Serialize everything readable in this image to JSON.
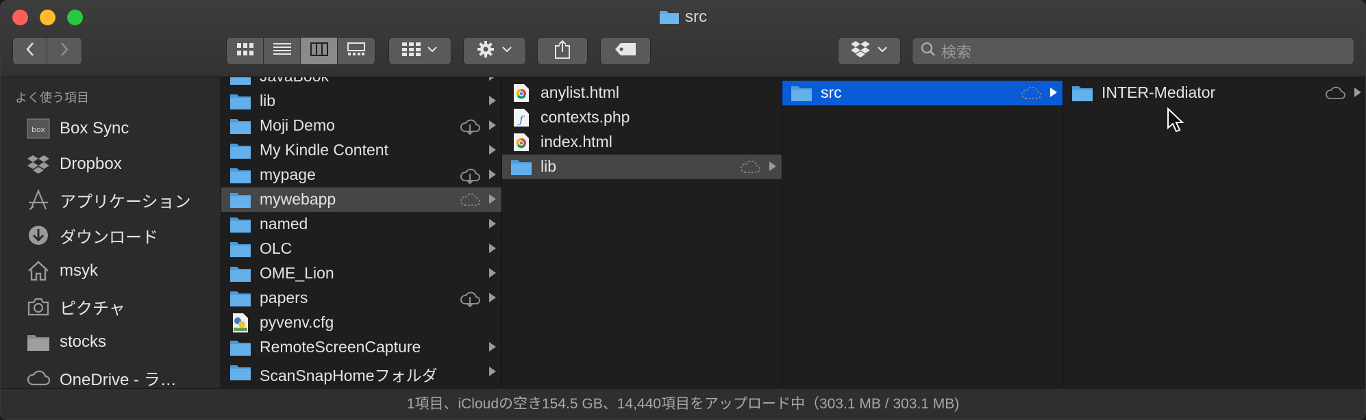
{
  "window": {
    "title": "src"
  },
  "toolbar": {
    "search_placeholder": "検索",
    "icons": [
      "back-icon",
      "forward-icon",
      "icon-view-icon",
      "list-view-icon",
      "column-view-icon",
      "gallery-view-icon",
      "group-icon",
      "gear-icon",
      "share-icon",
      "tag-icon",
      "dropbox-icon",
      "search-icon"
    ]
  },
  "sidebar": {
    "header": "よく使う項目",
    "items": [
      {
        "label": "Box Sync",
        "icon": "box-icon"
      },
      {
        "label": "Dropbox",
        "icon": "dropbox-icon"
      },
      {
        "label": "アプリケーション",
        "icon": "applications-icon"
      },
      {
        "label": "ダウンロード",
        "icon": "download-icon"
      },
      {
        "label": "msyk",
        "icon": "home-icon"
      },
      {
        "label": "ピクチャ",
        "icon": "camera-icon"
      },
      {
        "label": "stocks",
        "icon": "folder-icon"
      },
      {
        "label": "OneDrive - ラ…",
        "icon": "cloud-icon"
      }
    ]
  },
  "column1": {
    "items": [
      {
        "name": "JavaBook",
        "type": "folder",
        "cloud": "",
        "arrow": true,
        "state": ""
      },
      {
        "name": "lib",
        "type": "folder",
        "cloud": "",
        "arrow": true,
        "state": ""
      },
      {
        "name": "Moji Demo",
        "type": "folder",
        "cloud": "download",
        "arrow": true,
        "state": ""
      },
      {
        "name": "My Kindle Content",
        "type": "folder",
        "cloud": "",
        "arrow": true,
        "state": ""
      },
      {
        "name": "mypage",
        "type": "folder",
        "cloud": "download",
        "arrow": true,
        "state": ""
      },
      {
        "name": "mywebapp",
        "type": "folder",
        "cloud": "dashed",
        "arrow": true,
        "state": "selected-inactive"
      },
      {
        "name": "named",
        "type": "folder",
        "cloud": "",
        "arrow": true,
        "state": ""
      },
      {
        "name": "OLC",
        "type": "folder",
        "cloud": "",
        "arrow": true,
        "state": ""
      },
      {
        "name": "OME_Lion",
        "type": "folder",
        "cloud": "",
        "arrow": true,
        "state": ""
      },
      {
        "name": "papers",
        "type": "folder",
        "cloud": "download",
        "arrow": true,
        "state": ""
      },
      {
        "name": "pyvenv.cfg",
        "type": "cfg",
        "cloud": "",
        "arrow": false,
        "state": ""
      },
      {
        "name": "RemoteScreenCapture",
        "type": "folder",
        "cloud": "",
        "arrow": true,
        "state": ""
      },
      {
        "name": "ScanSnapHomeフォルダ",
        "type": "folder",
        "cloud": "",
        "arrow": true,
        "state": ""
      }
    ]
  },
  "column2": {
    "items": [
      {
        "name": "anylist.html",
        "type": "chrome",
        "cloud": "",
        "arrow": false,
        "state": ""
      },
      {
        "name": "contexts.php",
        "type": "php",
        "cloud": "",
        "arrow": false,
        "state": ""
      },
      {
        "name": "index.html",
        "type": "chrome",
        "cloud": "",
        "arrow": false,
        "state": ""
      },
      {
        "name": "lib",
        "type": "folder",
        "cloud": "dashed",
        "arrow": true,
        "state": "selected-inactive"
      }
    ]
  },
  "column3": {
    "items": [
      {
        "name": "src",
        "type": "folder",
        "cloud": "dashed",
        "arrow": true,
        "state": "selected-active"
      }
    ]
  },
  "column4": {
    "items": [
      {
        "name": "INTER-Mediator",
        "type": "folder",
        "cloud": "outline",
        "arrow": true,
        "state": ""
      }
    ]
  },
  "statusbar": {
    "text": "1項目、iCloudの空き154.5 GB、14,440項目をアップロード中（303.1 MB / 303.1 MB)"
  },
  "colors": {
    "accent": "#0a5bd6",
    "folder": "#5aa9e6"
  }
}
